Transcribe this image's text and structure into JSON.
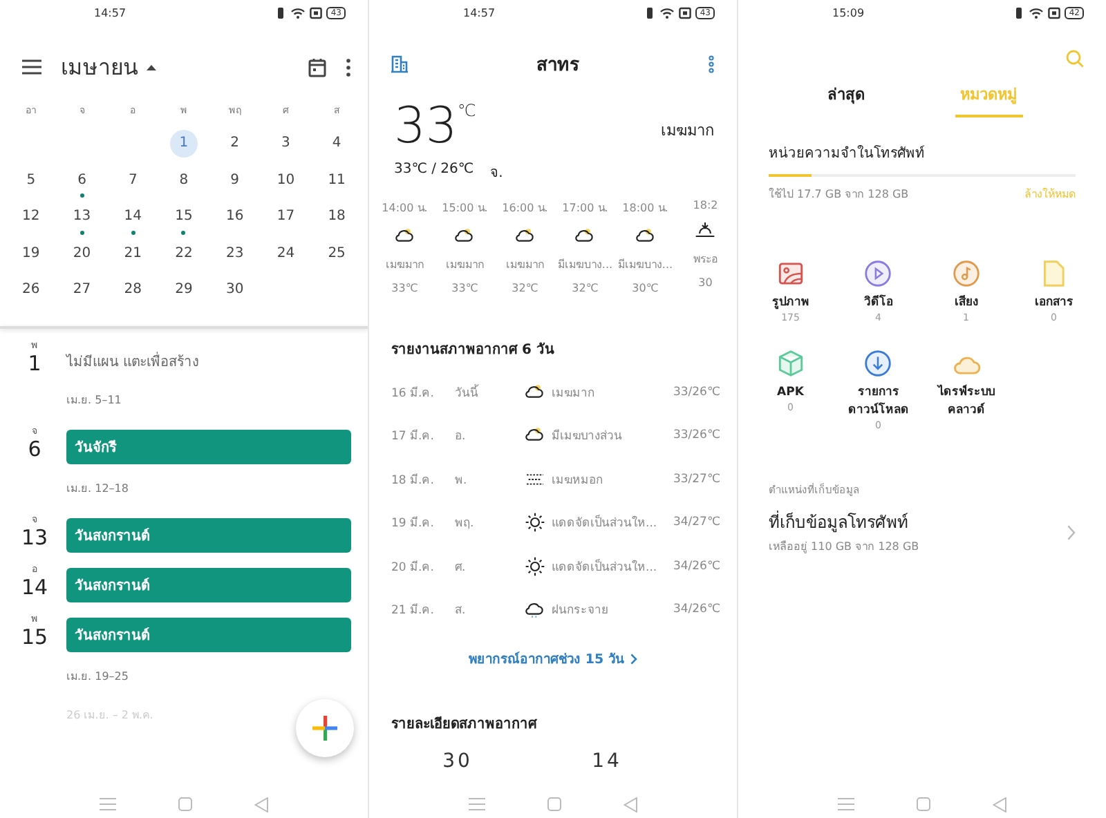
{
  "calendar": {
    "status_bar": {
      "time": "14:57",
      "battery": "43"
    },
    "month_title": "เมษายน",
    "weekdays": [
      "อา",
      "จ",
      "อ",
      "พ",
      "พฤ",
      "ศ",
      "ส"
    ],
    "weeks": [
      [
        {
          "kind": "blank"
        },
        {
          "kind": "blank"
        },
        {
          "kind": "blank"
        },
        {
          "kind": "day",
          "day": "1",
          "selected": true,
          "has_event": false
        },
        {
          "kind": "day",
          "day": "2",
          "selected": false,
          "has_event": false
        },
        {
          "kind": "day",
          "day": "3",
          "selected": false,
          "has_event": false
        },
        {
          "kind": "day",
          "day": "4",
          "selected": false,
          "has_event": false
        }
      ],
      [
        {
          "kind": "day",
          "day": "5",
          "selected": false,
          "has_event": false
        },
        {
          "kind": "day",
          "day": "6",
          "selected": false,
          "has_event": true
        },
        {
          "kind": "day",
          "day": "7",
          "selected": false,
          "has_event": false
        },
        {
          "kind": "day",
          "day": "8",
          "selected": false,
          "has_event": false
        },
        {
          "kind": "day",
          "day": "9",
          "selected": false,
          "has_event": false
        },
        {
          "kind": "day",
          "day": "10",
          "selected": false,
          "has_event": false
        },
        {
          "kind": "day",
          "day": "11",
          "selected": false,
          "has_event": false
        }
      ],
      [
        {
          "kind": "day",
          "day": "12",
          "selected": false,
          "has_event": false
        },
        {
          "kind": "day",
          "day": "13",
          "selected": false,
          "has_event": true
        },
        {
          "kind": "day",
          "day": "14",
          "selected": false,
          "has_event": true
        },
        {
          "kind": "day",
          "day": "15",
          "selected": false,
          "has_event": true
        },
        {
          "kind": "day",
          "day": "16",
          "selected": false,
          "has_event": false
        },
        {
          "kind": "day",
          "day": "17",
          "selected": false,
          "has_event": false
        },
        {
          "kind": "day",
          "day": "18",
          "selected": false,
          "has_event": false
        }
      ],
      [
        {
          "kind": "day",
          "day": "19",
          "selected": false,
          "has_event": false
        },
        {
          "kind": "day",
          "day": "20",
          "selected": false,
          "has_event": false
        },
        {
          "kind": "day",
          "day": "21",
          "selected": false,
          "has_event": false
        },
        {
          "kind": "day",
          "day": "22",
          "selected": false,
          "has_event": false
        },
        {
          "kind": "day",
          "day": "23",
          "selected": false,
          "has_event": false
        },
        {
          "kind": "day",
          "day": "24",
          "selected": false,
          "has_event": false
        },
        {
          "kind": "day",
          "day": "25",
          "selected": false,
          "has_event": false
        }
      ],
      [
        {
          "kind": "day",
          "day": "26",
          "selected": false,
          "has_event": false
        },
        {
          "kind": "day",
          "day": "27",
          "selected": false,
          "has_event": false
        },
        {
          "kind": "day",
          "day": "28",
          "selected": false,
          "has_event": false
        },
        {
          "kind": "day",
          "day": "29",
          "selected": false,
          "has_event": false
        },
        {
          "kind": "day",
          "day": "30",
          "selected": false,
          "has_event": false
        },
        {
          "kind": "blank"
        },
        {
          "kind": "blank"
        }
      ]
    ],
    "agenda": [
      {
        "kind": "empty_day",
        "weekday": "พ",
        "day": "1",
        "text": "ไม่มีแผน แตะเพื่อสร้าง"
      },
      {
        "kind": "week_header",
        "text": "เม.ย. 5–11",
        "faded": false
      },
      {
        "kind": "event_day",
        "weekday": "จ",
        "day": "6",
        "event": "วันจักรี"
      },
      {
        "kind": "week_header",
        "text": "เม.ย. 12–18",
        "faded": false
      },
      {
        "kind": "event_day",
        "weekday": "จ",
        "day": "13",
        "event": "วันสงกรานต์"
      },
      {
        "kind": "event_day",
        "weekday": "อ",
        "day": "14",
        "event": "วันสงกรานต์"
      },
      {
        "kind": "event_day",
        "weekday": "พ",
        "day": "15",
        "event": "วันสงกรานต์"
      },
      {
        "kind": "week_header",
        "text": "เม.ย. 19–25",
        "faded": false
      },
      {
        "kind": "week_header",
        "text": "26 เม.ย. – 2 พ.ค.",
        "faded": true
      }
    ]
  },
  "weather": {
    "status_bar": {
      "time": "14:57",
      "battery": "43"
    },
    "location": "สาทร",
    "temperature": "33",
    "unit": "℃",
    "condition": "เมฆมาก",
    "range": "33℃ / 26℃",
    "day": "จ.",
    "hourly": [
      {
        "time": "14:00 น.",
        "kind": "cloudy",
        "condition": "เมฆมาก",
        "temp": "33℃"
      },
      {
        "time": "15:00 น.",
        "kind": "cloudy",
        "condition": "เมฆมาก",
        "temp": "33℃"
      },
      {
        "time": "16:00 น.",
        "kind": "cloudy",
        "condition": "เมฆมาก",
        "temp": "32℃"
      },
      {
        "time": "17:00 น.",
        "kind": "cloudy",
        "condition": "มีเมฆบาง...",
        "temp": "32℃"
      },
      {
        "time": "18:00 น.",
        "kind": "cloudy",
        "condition": "มีเมฆบาง...",
        "temp": "30℃"
      },
      {
        "time": "18:2",
        "kind": "sunset",
        "condition": "พระอ",
        "temp": "30"
      }
    ],
    "daily_title": "รายงานสภาพอากาศ 6 วัน",
    "daily": [
      {
        "date": "16 มี.ค.",
        "day": "วันนี้",
        "kind": "cloudy",
        "condition": "เมฆมาก",
        "range": "33/26℃"
      },
      {
        "date": "17 มี.ค.",
        "day": "อ.",
        "kind": "cloudy",
        "condition": "มีเมฆบางส่วน",
        "range": "33/26℃"
      },
      {
        "date": "18 มี.ค.",
        "day": "พ.",
        "kind": "fog",
        "condition": "เมฆหมอก",
        "range": "33/27℃"
      },
      {
        "date": "19 มี.ค.",
        "day": "พฤ.",
        "kind": "sunny",
        "condition": "แดดจัดเป็นส่วนให...",
        "range": "34/27℃"
      },
      {
        "date": "20 มี.ค.",
        "day": "ศ.",
        "kind": "sunny",
        "condition": "แดดจัดเป็นส่วนให...",
        "range": "34/26℃"
      },
      {
        "date": "21 มี.ค.",
        "day": "ส.",
        "kind": "showers",
        "condition": "ฝนกระจาย",
        "range": "34/26℃"
      }
    ],
    "forecast_link": "พยากรณ์อากาศช่วง 15 วัน",
    "details_title": "รายละเอียดสภาพอากาศ",
    "details_values": [
      "30",
      "14"
    ]
  },
  "files": {
    "status_bar": {
      "time": "15:09",
      "battery": "42"
    },
    "tabs": [
      {
        "label": "ล่าสุด",
        "selected": false
      },
      {
        "label": "หมวดหมู่",
        "selected": true
      }
    ],
    "storage_title": "หน่วยความจำในโทรศัพท์",
    "level": 0.14,
    "used_text": "ใช้ไป 17.7 GB จาก 128 GB",
    "clear_link": "ล้างให้หมด",
    "categories": [
      {
        "kind": "image",
        "label": "รูปภาพ",
        "count": "175"
      },
      {
        "kind": "video",
        "label": "วิดีโอ",
        "count": "4"
      },
      {
        "kind": "audio",
        "label": "เสียง",
        "count": "1"
      },
      {
        "kind": "document",
        "label": "เอกสาร",
        "count": "0"
      },
      {
        "kind": "apk",
        "label": "APK",
        "count": "0"
      },
      {
        "kind": "download",
        "label": "รายการ\nดาวน์โหลด",
        "count": "0"
      },
      {
        "kind": "cloud",
        "label": "ไดรฟ์ระบบ\nคลาวด์"
      }
    ],
    "location_title": "ตำแหน่งที่เก็บข้อมูล",
    "storage_item": {
      "title": "ที่เก็บข้อมูลโทรศัพท์",
      "detail": "เหลืออยู่ 110 GB จาก 128 GB"
    }
  }
}
